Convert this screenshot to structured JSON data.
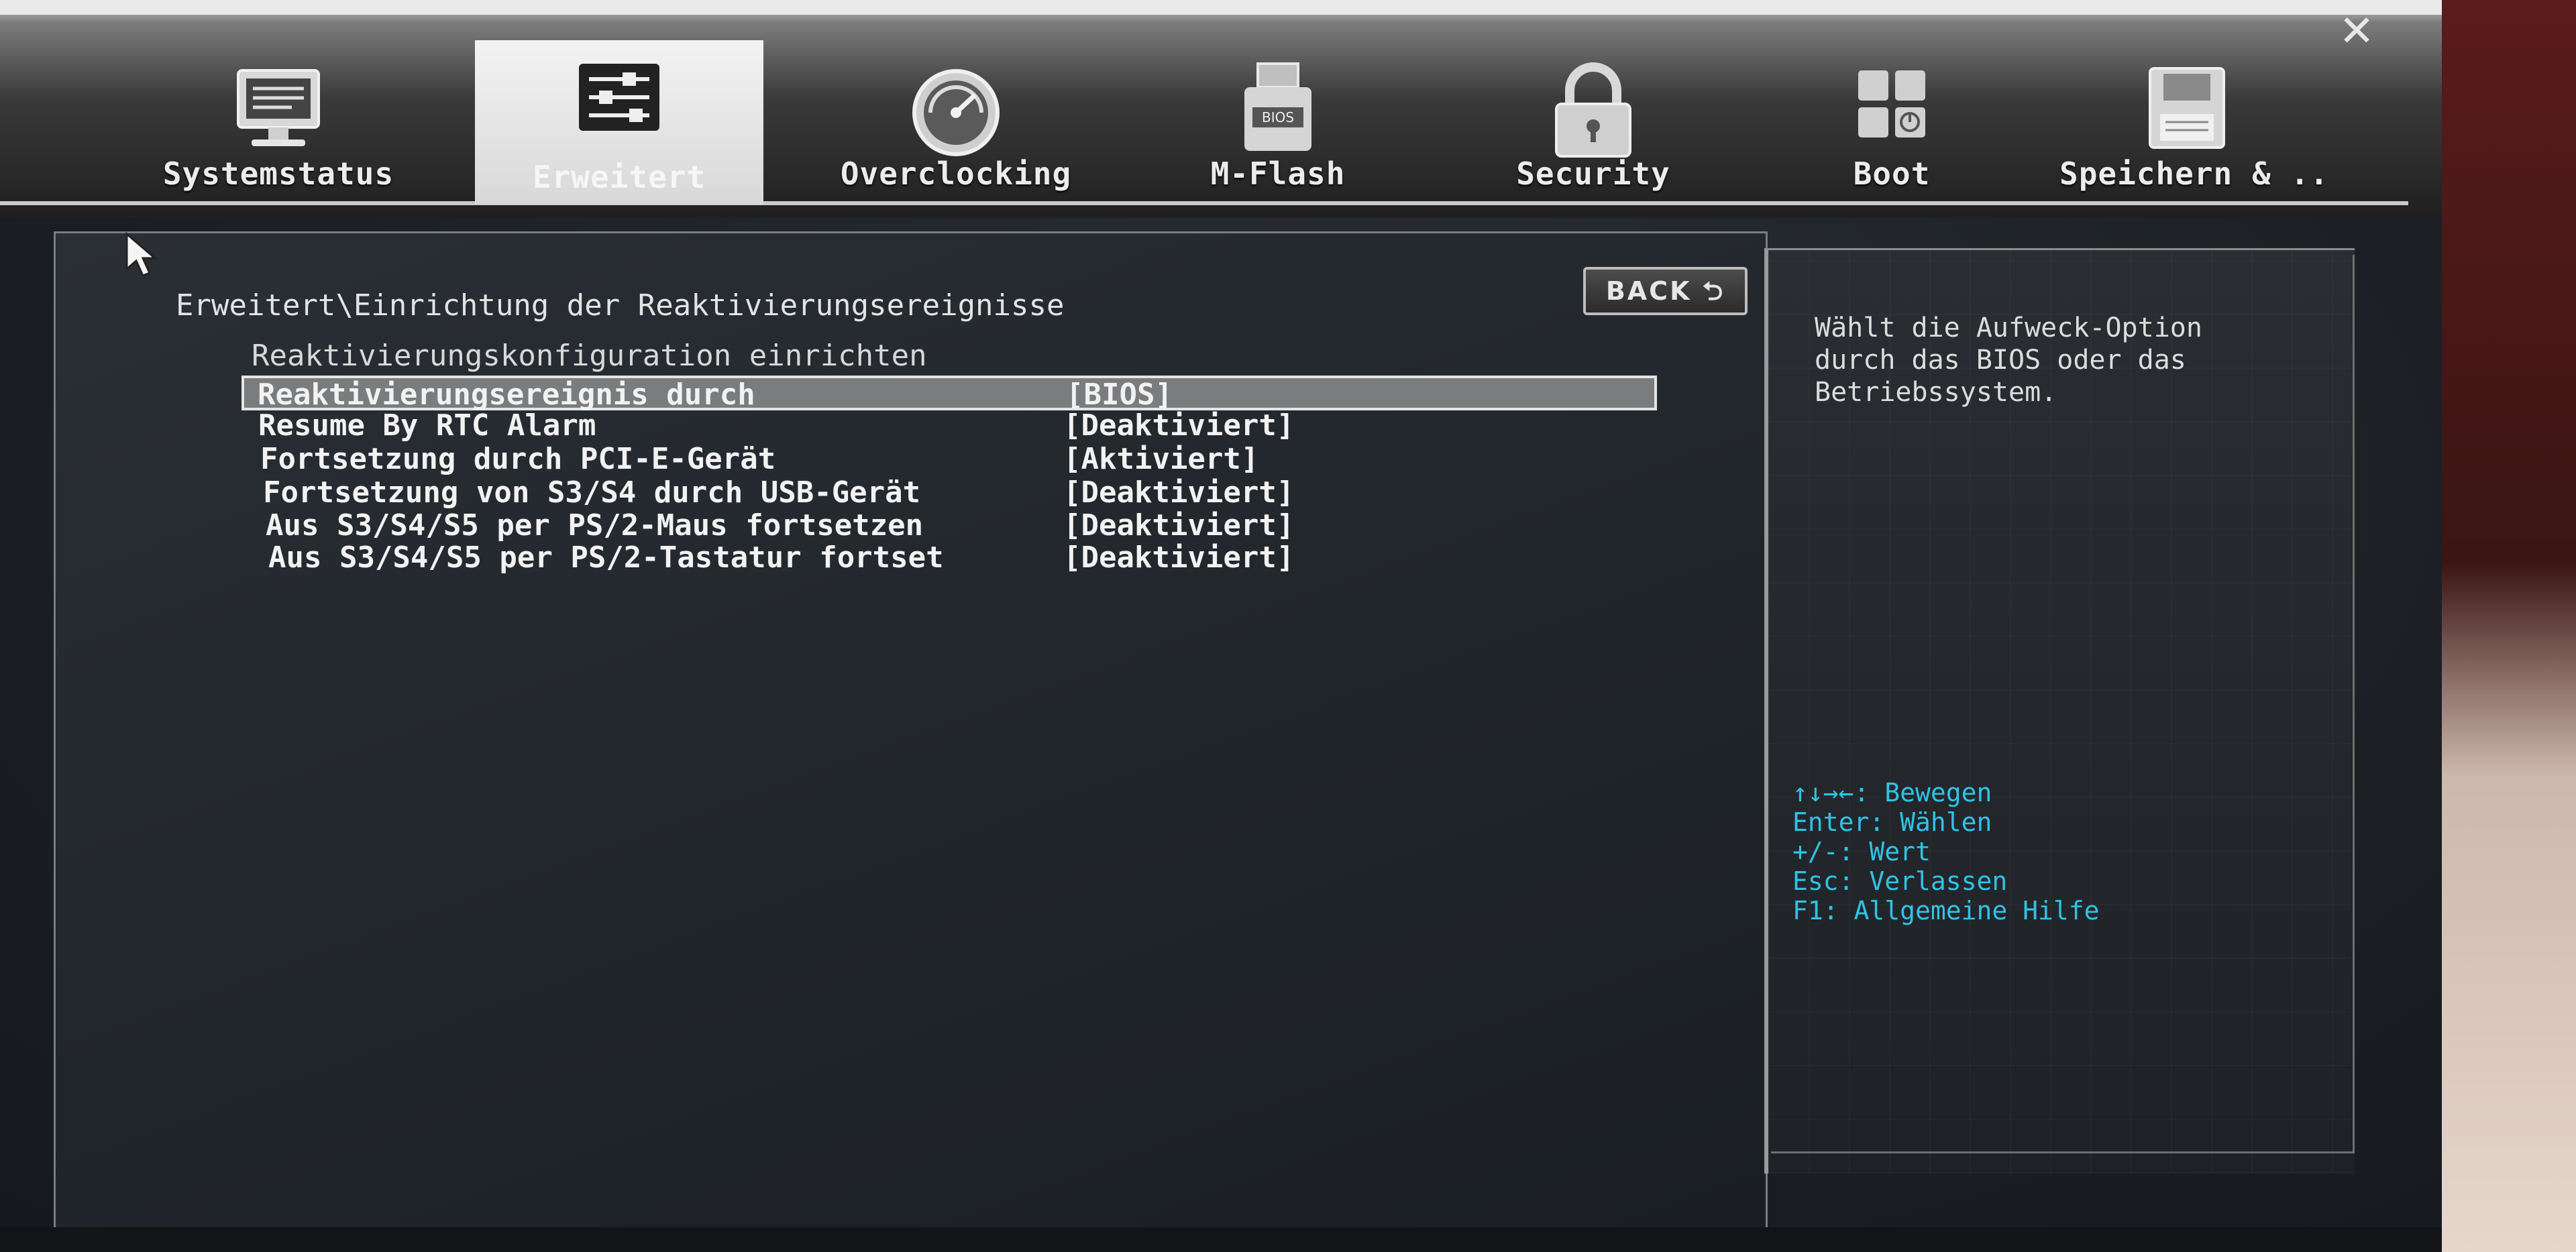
{
  "window": {
    "close_glyph": "✕"
  },
  "tabs": [
    {
      "label": "Systemstatus",
      "icon": "monitor-icon",
      "active": false
    },
    {
      "label": "Erweitert",
      "icon": "settings-panel-icon",
      "active": true
    },
    {
      "label": "Overclocking",
      "icon": "gauge-icon",
      "active": false
    },
    {
      "label": "M-Flash",
      "icon": "usb-flash-icon",
      "active": false
    },
    {
      "label": "Security",
      "icon": "padlock-icon",
      "active": false
    },
    {
      "label": "Boot",
      "icon": "boot-icon",
      "active": false
    },
    {
      "label": "Speichern & ..",
      "icon": "floppy-disk-icon",
      "active": false
    }
  ],
  "breadcrumb": "Erweitert\\Einrichtung der Reaktivierungsereignisse",
  "back_label": "BACK ⮌",
  "section_heading": "Reaktivierungskonfiguration einrichten",
  "settings": [
    {
      "label": "Reaktivierungsereignis durch",
      "value": "[BIOS]"
    },
    {
      "label": "Resume By RTC Alarm",
      "value": "[Deaktiviert]"
    },
    {
      "label": "Fortsetzung durch PCI-E-Gerät",
      "value": "[Aktiviert]"
    },
    {
      "label": "Fortsetzung von S3/S4 durch USB-Gerät",
      "value": "[Deaktiviert]"
    },
    {
      "label": "Aus S3/S4/S5 per PS/2-Maus fortsetzen",
      "value": "[Deaktiviert]"
    },
    {
      "label": "Aus S3/S4/S5 per PS/2-Tastatur fortset",
      "value": "[Deaktiviert]"
    }
  ],
  "help": {
    "description": "Wählt die Aufweck-Option\ndurch das BIOS oder das\nBetriebssystem.",
    "keys": [
      "↑↓→←: Bewegen",
      "Enter: Wählen",
      "+/-: Wert",
      "Esc: Verlassen",
      "F1: Allgemeine Hilfe"
    ]
  },
  "colors": {
    "key_hint": "#2ec3e6",
    "selected_row": "#7a7c7e",
    "text": "#f2f2f2"
  }
}
